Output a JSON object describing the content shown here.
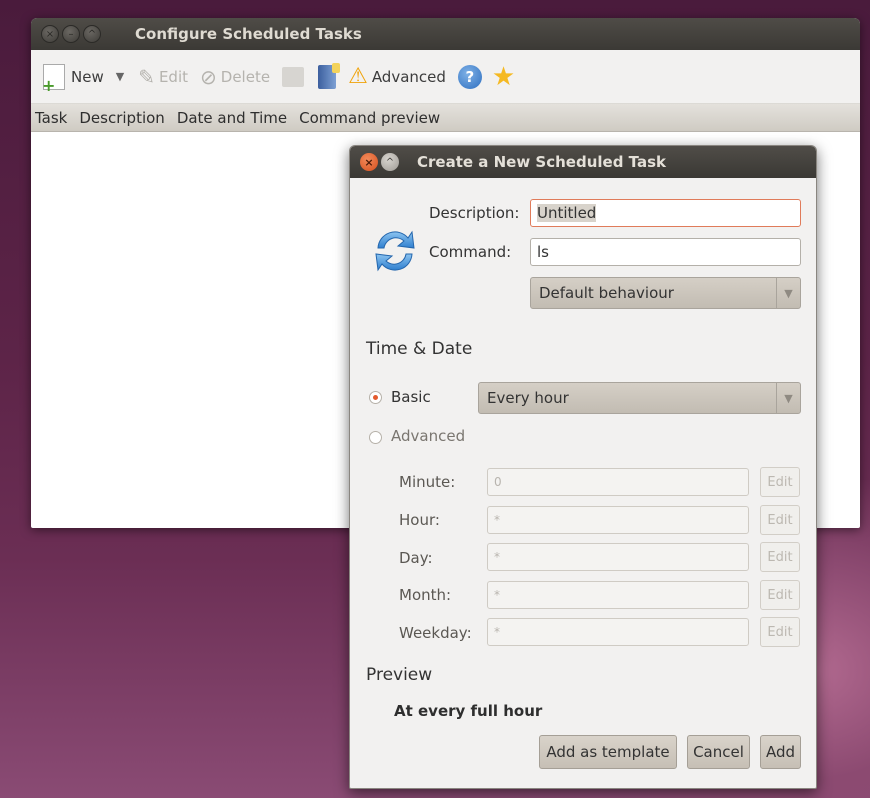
{
  "main_window": {
    "title": "Configure Scheduled Tasks",
    "toolbar": {
      "new_label": "New",
      "edit_label": "Edit",
      "delete_label": "Delete",
      "advanced_label": "Advanced"
    },
    "columns": [
      "Task",
      "Description",
      "Date and Time",
      "Command preview"
    ]
  },
  "dialog": {
    "title": "Create a New Scheduled Task",
    "description_label": "Description:",
    "description_value": "Untitled",
    "command_label": "Command:",
    "command_value": "ls",
    "behaviour_value": "Default behaviour",
    "time_date_heading": "Time & Date",
    "basic_label": "Basic",
    "basic_value": "Every hour",
    "advanced_label": "Advanced",
    "cron": [
      {
        "label": "Minute:",
        "value": "0",
        "edit": "Edit"
      },
      {
        "label": "Hour:",
        "value": "*",
        "edit": "Edit"
      },
      {
        "label": "Day:",
        "value": "*",
        "edit": "Edit"
      },
      {
        "label": "Month:",
        "value": "*",
        "edit": "Edit"
      },
      {
        "label": "Weekday:",
        "value": "*",
        "edit": "Edit"
      }
    ],
    "preview_heading": "Preview",
    "preview_text": "At every full hour",
    "buttons": {
      "add_template": "Add as template",
      "cancel": "Cancel",
      "add": "Add"
    }
  }
}
